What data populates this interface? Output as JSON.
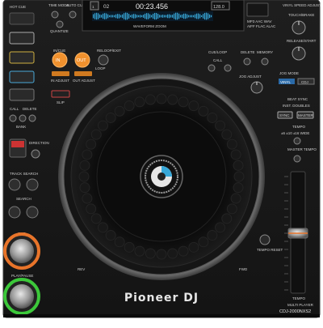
{
  "device": {
    "brand": "Pioneer DJ",
    "model": "CDJ-2000NXS2",
    "model_line": "MULTI PLAYER"
  },
  "display": {
    "track_number": "02",
    "time": "00:23.456",
    "bpm": "128.0",
    "format_line1": "MP3 AAC WAV",
    "format_line2": "AIFF FLAC ALAC",
    "sub_label": "WAVEFORM ZOOM"
  },
  "top_left": {
    "hot_cue": "HOT CUE",
    "time_mode": "TIME MODE",
    "auto_cue": "AUTO CUE",
    "quantize": "QUANTIZE"
  },
  "top_right": {
    "vinyl_speed": "VINYL SPEED ADJUST",
    "touch_brake": "TOUCH/BRAKE",
    "release_start": "RELEASE/START"
  },
  "loop": {
    "in": "IN",
    "out": "OUT",
    "reloop": "RELOOP/EXIT",
    "in_adjust": "IN ADJUST",
    "out_adjust": "OUT ADJUST",
    "loop_label": "LOOP",
    "slip": "SLIP"
  },
  "cue_loop": {
    "title": "CUE/LOOP",
    "call": "CALL",
    "delete": "DELETE",
    "memory": "MEMORY"
  },
  "jog": {
    "adjust": "JOG ADJUST",
    "mode": "JOG MODE",
    "vinyl": "VINYL",
    "cdj": "CDJ",
    "rev": "REV",
    "fwd": "FWD",
    "tempo_reset": "TEMPO RESET"
  },
  "beat_sync": {
    "title": "BEAT SYNC",
    "inst_doubles": "INST. DOUBLES",
    "sync": "SYNC",
    "master": "MASTER"
  },
  "tempo": {
    "title": "TEMPO",
    "range": "±6 ±10 ±16 WIDE",
    "master_tempo": "MASTER TEMPO",
    "fader_label": "TEMPO"
  },
  "left_controls": {
    "call_label": "CALL",
    "delete_label": "DELETE",
    "bank": "BANK",
    "direction": "DIRECTION",
    "track_search": "TRACK SEARCH",
    "search": "SEARCH",
    "cue": "CUE",
    "play_pause": "PLAY/PAUSE"
  },
  "colors": {
    "cue_ring": "#e8742a",
    "play_ring": "#3cc83a",
    "loop_button": "#f0912e",
    "display_cyan": "#38a8d8",
    "body": "#1a1a1a"
  }
}
